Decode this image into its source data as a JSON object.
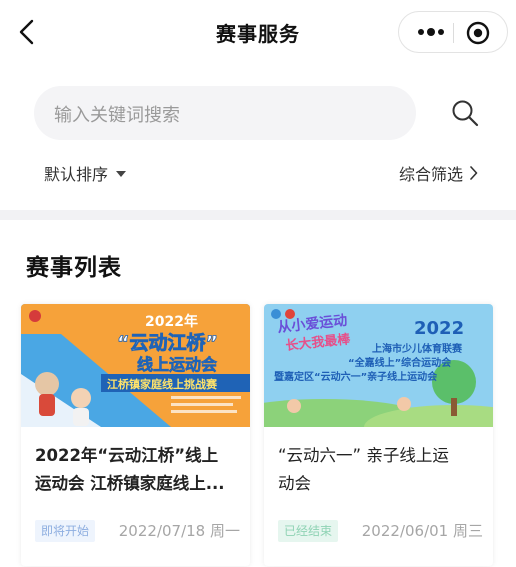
{
  "nav": {
    "title": "赛事服务"
  },
  "search": {
    "placeholder": "输入关键词搜索"
  },
  "filters": {
    "sort_label": "默认排序",
    "filter_label": "综合筛选"
  },
  "section": {
    "title": "赛事列表"
  },
  "events": [
    {
      "title_line1": "2022年“云动江桥”线上",
      "title_line2": "运动会 江桥镇家庭线上...",
      "status": "即将开始",
      "date": "2022/07/18 周一",
      "poster": {
        "year": "2022年",
        "headline": "“云动江桥”",
        "subhead": "线上运动会",
        "banner": "江桥镇家庭线上挑战赛"
      }
    },
    {
      "title_line1": "“云动六一” 亲子线上运",
      "title_line2": "动会",
      "status": "已经结束",
      "date": "2022/06/01 周三",
      "poster": {
        "slogan1": "从小爱运动",
        "slogan2": "长大我最棒",
        "year": "2022",
        "line1": "上海市少儿体育联赛",
        "line2": "“全嘉线上”综合运动会",
        "line3": "暨嘉定区“云动六一”亲子线上运动会"
      }
    }
  ],
  "colors": {
    "upcoming_badge": "#8eaee0",
    "ended_badge": "#8fd3b4",
    "poster1_bg": "#f6a23a",
    "poster2_bg": "#8fd0f0"
  }
}
